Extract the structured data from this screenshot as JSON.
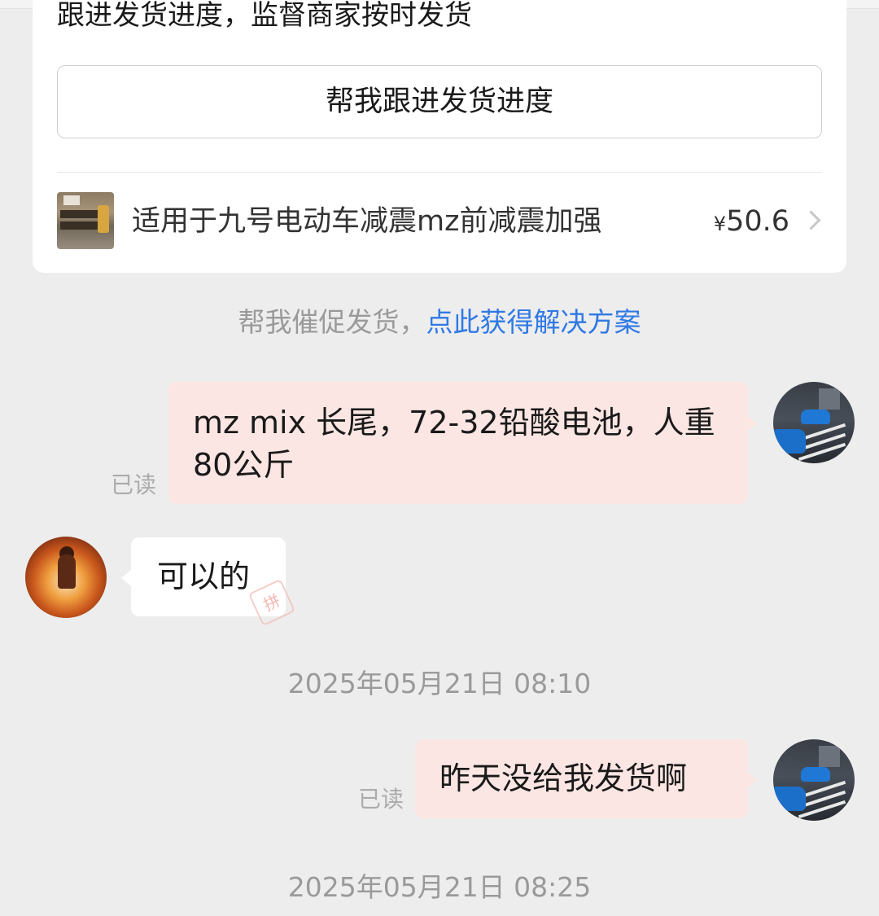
{
  "order_card": {
    "description": "跟进发货进度，监督商家按时发货",
    "follow_button_label": "帮我跟进发货进度",
    "product": {
      "title": "适用于九号电动车减震mz前减震加强",
      "price_symbol": "¥",
      "price": "50.6"
    }
  },
  "hint": {
    "text": "帮我催促发货，",
    "link_text": "点此获得解决方案"
  },
  "messages": [
    {
      "from": "me",
      "text": "mz mix 长尾，72-32铅酸电池，人重80公斤",
      "status": "已读"
    },
    {
      "from": "seller",
      "text": "可以的"
    },
    {
      "type": "timestamp",
      "text": "2025年05月21日 08:10"
    },
    {
      "from": "me",
      "text": "昨天没给我发货啊",
      "status": "已读"
    },
    {
      "type": "timestamp",
      "text": "2025年05月21日 08:25"
    }
  ],
  "colors": {
    "background": "#ededed",
    "outgoing_bubble": "#fbe6e3",
    "incoming_bubble": "#ffffff",
    "link": "#2f79e6",
    "muted_text": "#9a9a9a"
  }
}
